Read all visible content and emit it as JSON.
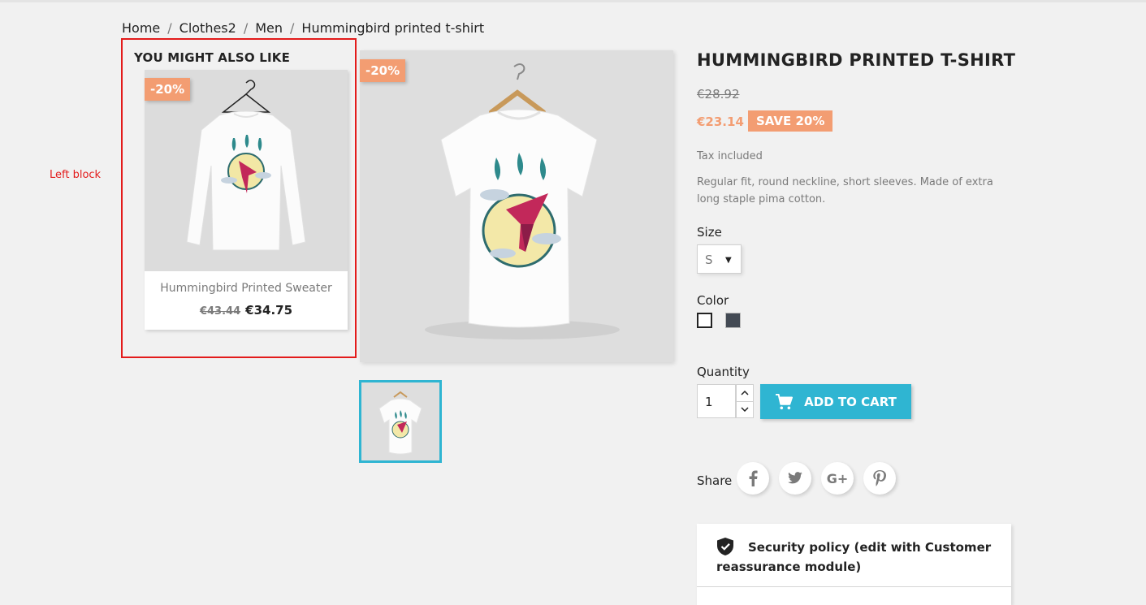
{
  "breadcrumb": [
    "Home",
    "Clothes2",
    "Men",
    "Hummingbird printed t-shirt"
  ],
  "annotation_label": "Left block",
  "left_block": {
    "title": "YOU MIGHT ALSO LIKE",
    "product": {
      "flag": "-20%",
      "name": "Hummingbird Printed Sweater",
      "regular_price": "€43.44",
      "price": "€34.75"
    }
  },
  "gallery": {
    "flag": "-20%"
  },
  "product": {
    "title": "HUMMINGBIRD PRINTED T-SHIRT",
    "regular_price": "€28.92",
    "price": "€23.14",
    "discount": "SAVE 20%",
    "tax": "Tax included",
    "description": "Regular fit, round neckline, short sleeves. Made of extra long staple pima cotton.",
    "size_label": "Size",
    "size_value": "S",
    "color_label": "Color",
    "colors": [
      "#ffffff",
      "#434a54"
    ],
    "quantity_label": "Quantity",
    "quantity_value": "1",
    "add_to_cart": "ADD TO CART",
    "share_label": "Share",
    "social": [
      "facebook-icon",
      "twitter-icon",
      "google-plus-icon",
      "pinterest-icon"
    ],
    "reassurance": "Security policy (edit with Customer reassurance module)"
  },
  "colors": {
    "accent": "#2fb5d2",
    "discount": "#f39d72",
    "annotation": "#e31b1b"
  }
}
